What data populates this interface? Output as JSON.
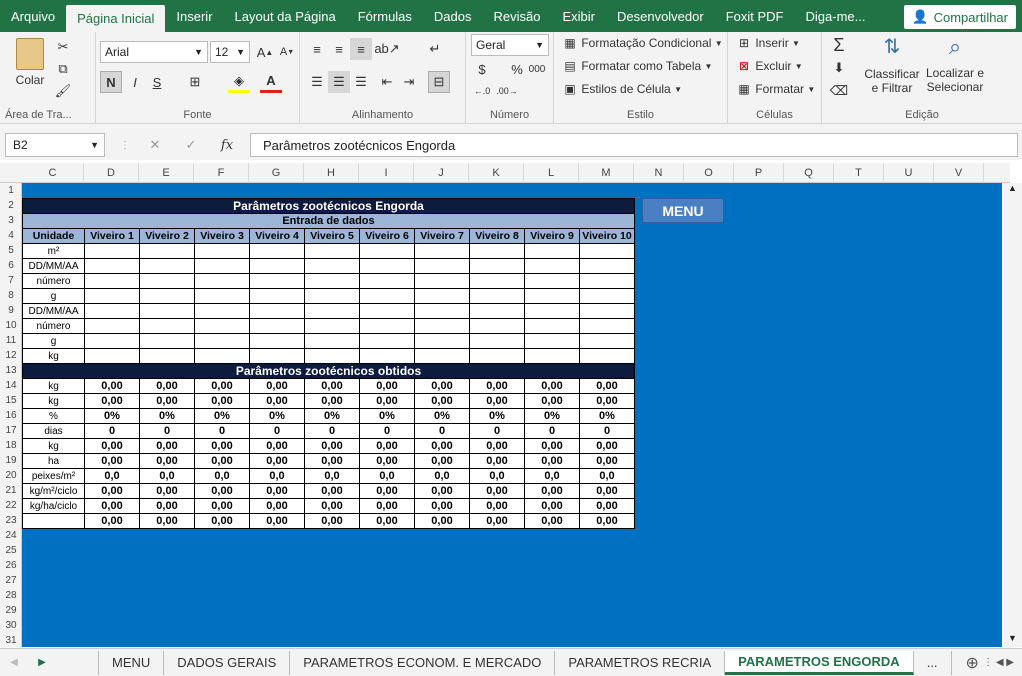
{
  "ribbon_tabs": [
    "Arquivo",
    "Página Inicial",
    "Inserir",
    "Layout da Página",
    "Fórmulas",
    "Dados",
    "Revisão",
    "Exibir",
    "Desenvolvedor",
    "Foxit PDF",
    "Diga-me..."
  ],
  "active_tab": "Página Inicial",
  "share_label": "Compartilhar",
  "clipboard": {
    "paste": "Colar",
    "label": "Área de Tra..."
  },
  "font": {
    "name": "Arial",
    "size": "12",
    "bold": "N",
    "italic": "I",
    "underline": "S",
    "label": "Fonte"
  },
  "alignment": {
    "label": "Alinhamento"
  },
  "number": {
    "format": "Geral",
    "label": "Número",
    "percent": "%",
    "thousands": "000"
  },
  "styles": {
    "conditional": "Formatação Condicional",
    "table": "Formatar como Tabela",
    "cell": "Estilos de Célula",
    "label": "Estilo"
  },
  "cells": {
    "insert": "Inserir",
    "delete": "Excluir",
    "format": "Formatar",
    "label": "Células"
  },
  "editing": {
    "sort": "Classificar",
    "sort2": "e Filtrar",
    "find": "Localizar e",
    "find2": "Selecionar",
    "label": "Edição"
  },
  "formula_bar": {
    "name_box": "B2",
    "fx": "fx",
    "content": "Parâmetros zootécnicos Engorda"
  },
  "columns": [
    "C",
    "D",
    "E",
    "F",
    "G",
    "H",
    "I",
    "J",
    "K",
    "L",
    "M",
    "N",
    "O",
    "P",
    "Q",
    "T",
    "U",
    "V"
  ],
  "rows": [
    "1",
    "2",
    "3",
    "4",
    "5",
    "6",
    "7",
    "8",
    "9",
    "10",
    "11",
    "12",
    "13",
    "14",
    "15",
    "16",
    "17",
    "18",
    "19",
    "20",
    "21",
    "22",
    "23",
    "24",
    "25",
    "26",
    "27",
    "28",
    "29",
    "30",
    "31"
  ],
  "table": {
    "title": "Parâmetros zootécnicos Engorda",
    "input_header": "Entrada de dados",
    "unit_header": "Unidade",
    "viveiros": [
      "Viveiro 1",
      "Viveiro 2",
      "Viveiro 3",
      "Viveiro 4",
      "Viveiro 5",
      "Viveiro 6",
      "Viveiro 7",
      "Viveiro 8",
      "Viveiro 9",
      "Viveiro 10"
    ],
    "input_units": [
      "m²",
      "DD/MM/AA",
      "número",
      "g",
      "DD/MM/AA",
      "número",
      "g",
      "kg"
    ],
    "output_header": "Parâmetros zootécnicos obtidos",
    "output_rows": [
      {
        "unit": "kg",
        "value": "0,00"
      },
      {
        "unit": "kg",
        "value": "0,00"
      },
      {
        "unit": "%",
        "value": "0%"
      },
      {
        "unit": "dias",
        "value": "0"
      },
      {
        "unit": "kg",
        "value": "0,00"
      },
      {
        "unit": "ha",
        "value": "0,00"
      },
      {
        "unit": "peixes/m²",
        "value": "0,0"
      },
      {
        "unit": "kg/m²/ciclo",
        "value": "0,00"
      },
      {
        "unit": "kg/ha/ciclo",
        "value": "0,00"
      },
      {
        "unit": "",
        "value": "0,00"
      }
    ]
  },
  "menu_button": "MENU",
  "sheet_tabs": [
    "MENU",
    "DADOS GERAIS",
    "PARAMETROS ECONOM. E MERCADO",
    "PARAMETROS RECRIA",
    "PARAMETROS ENGORDA",
    "..."
  ],
  "active_sheet": "PARAMETROS ENGORDA"
}
